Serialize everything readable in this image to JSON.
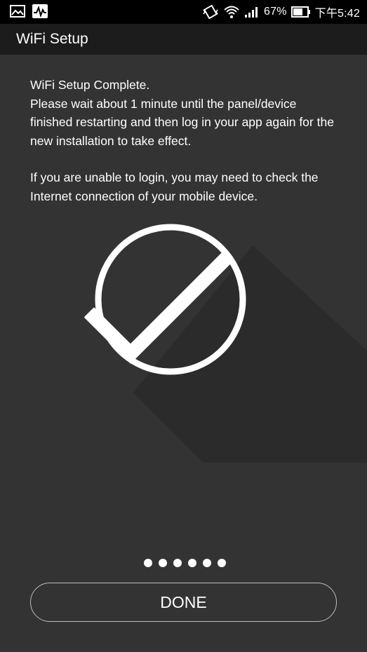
{
  "status_bar": {
    "icons_left": [
      "image-icon",
      "activity-icon"
    ],
    "icons_right": [
      "vibrate-icon",
      "wifi-icon",
      "signal-icon",
      "battery-icon"
    ],
    "battery_percent": "67%",
    "time": "下午5:42"
  },
  "app_bar": {
    "title": "WiFi Setup"
  },
  "content": {
    "heading": "WiFi Setup Complete.",
    "paragraph1": "Please wait about 1 minute until the panel/device finished restarting and then log in your app again for the new installation to take effect.",
    "paragraph2": "If you are unable to login, you may need to check the Internet connection of your mobile device."
  },
  "illustration": {
    "icon": "checkmark-circle-icon"
  },
  "pagination": {
    "total_dots": 6
  },
  "actions": {
    "done_label": "DONE"
  },
  "colors": {
    "background": "#333333",
    "status_bar": "#000000",
    "app_bar": "#1c1c1c",
    "foreground": "#ffffff"
  }
}
